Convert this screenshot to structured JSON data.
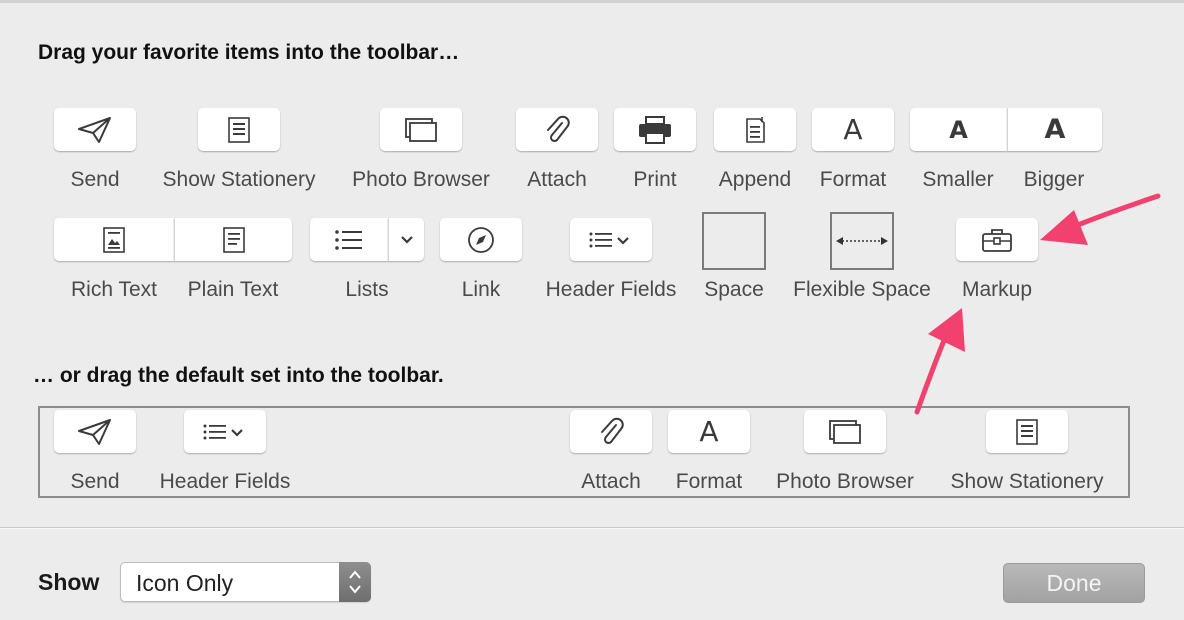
{
  "headings": {
    "favorites": "Drag your favorite items into the toolbar…",
    "default_set": "… or drag the default set into the toolbar."
  },
  "row1": {
    "send": "Send",
    "show_stationery": "Show Stationery",
    "photo_browser": "Photo Browser",
    "attach": "Attach",
    "print": "Print",
    "append": "Append",
    "format": "Format",
    "smaller": "Smaller",
    "bigger": "Bigger",
    "format_glyph": "A",
    "smaller_glyph": "A",
    "bigger_glyph": "A"
  },
  "row2": {
    "rich_text": "Rich Text",
    "plain_text": "Plain Text",
    "lists": "Lists",
    "link": "Link",
    "header_fields": "Header Fields",
    "space": "Space",
    "flexible_space": "Flexible Space",
    "markup": "Markup"
  },
  "default_set": {
    "send": "Send",
    "header_fields": "Header Fields",
    "attach": "Attach",
    "format": "Format",
    "photo_browser": "Photo Browser",
    "show_stationery": "Show Stationery",
    "format_glyph": "A"
  },
  "footer": {
    "show_label": "Show",
    "show_value": "Icon Only",
    "done_label": "Done"
  },
  "colors": {
    "background": "#ececec",
    "annotation_arrow": "#f2416f",
    "done_button": "#a8a8a8"
  },
  "icons": {
    "send": "paper-plane-icon",
    "show_stationery": "stationery-icon",
    "photo_browser": "photo-stack-icon",
    "attach": "paperclip-icon",
    "print": "printer-icon",
    "append": "append-document-icon",
    "rich_text": "rich-text-icon",
    "plain_text": "plain-text-icon",
    "lists": "list-icon",
    "link": "compass-icon",
    "header_fields": "list-chevron-icon",
    "markup": "toolbox-icon"
  }
}
